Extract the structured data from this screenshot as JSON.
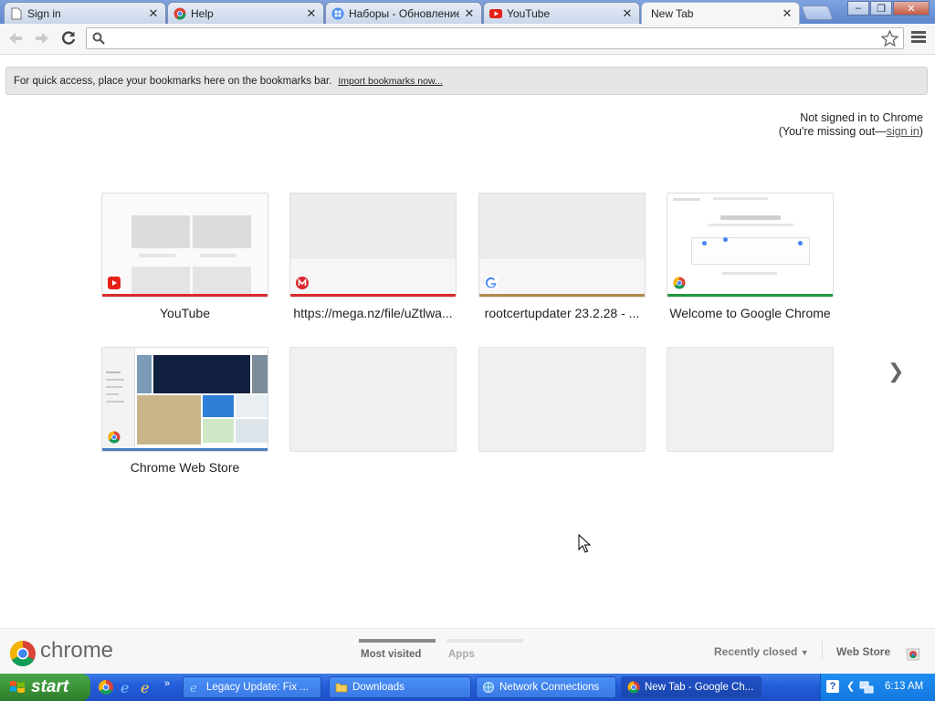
{
  "browser": {
    "tabs": [
      {
        "title": "Sign in",
        "icon": "page-icon"
      },
      {
        "title": "Help",
        "icon": "chrome-icon"
      },
      {
        "title": "Наборы - Обновление",
        "icon": "chrome-apps-icon"
      },
      {
        "title": "YouTube",
        "icon": "youtube-icon"
      },
      {
        "title": "New Tab",
        "icon": "none",
        "active": true
      }
    ],
    "close_glyph": "✕",
    "window_controls": {
      "minimize": "–",
      "restore": "❐",
      "close": "✕"
    },
    "omnibox": {
      "value": "",
      "placeholder": ""
    }
  },
  "bookmarks_hint": {
    "text": "For quick access, place your bookmarks here on the bookmarks bar.",
    "link": "Import bookmarks now..."
  },
  "signin": {
    "line1": "Not signed in to Chrome",
    "line2_prefix": "(You're missing out—",
    "link": "sign in",
    "line2_suffix": ")"
  },
  "most_visited": [
    {
      "title": "YouTube",
      "bar_color": "#d92b2b",
      "favicon": "youtube-icon"
    },
    {
      "title": "https://mega.nz/file/uZtlwa...",
      "bar_color": "#d92b2b",
      "favicon": "mega-icon"
    },
    {
      "title": "rootcertupdater 23.2.28 - ...",
      "bar_color": "#b08a4e",
      "favicon": "google-icon"
    },
    {
      "title": "Welcome to Google Chrome",
      "bar_color": "#1f9a3d",
      "favicon": "chrome-icon"
    },
    {
      "title": "Chrome Web Store",
      "bar_color": "#4a7fc0",
      "favicon": "chrome-icon"
    },
    {
      "title": "",
      "empty": true
    },
    {
      "title": "",
      "empty": true
    },
    {
      "title": "",
      "empty": true
    }
  ],
  "next_arrow": "❯",
  "footer": {
    "logo_text": "chrome",
    "tabs": [
      {
        "label": "Most visited",
        "active": true
      },
      {
        "label": "Apps",
        "active": false
      }
    ],
    "recently_closed": "Recently closed",
    "web_store": "Web Store"
  },
  "taskbar": {
    "start": "start",
    "windows": [
      {
        "label": "Legacy Update: Fix ...",
        "icon": "ie-icon"
      },
      {
        "label": "Downloads",
        "icon": "folder-icon"
      },
      {
        "label": "Network Connections",
        "icon": "network-icon"
      },
      {
        "label": "New Tab - Google Ch...",
        "icon": "chrome-icon",
        "active": true
      }
    ],
    "clock": "6:13 AM"
  }
}
